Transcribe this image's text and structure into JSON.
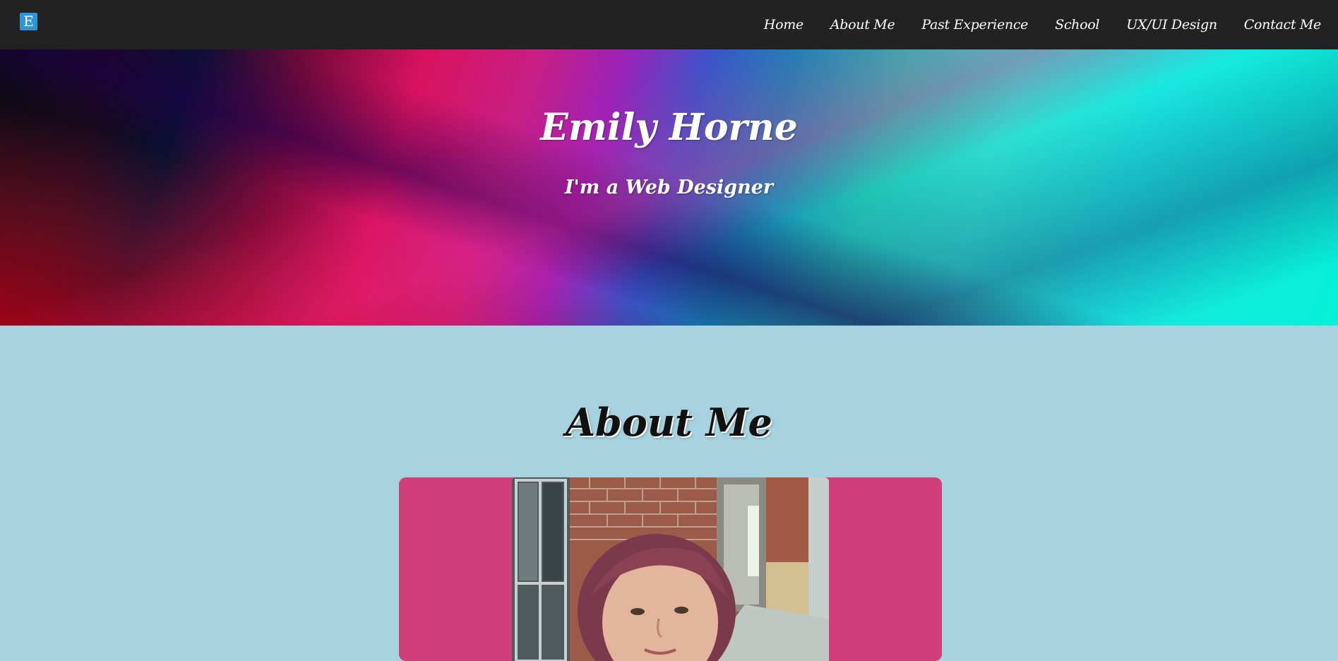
{
  "navbar": {
    "logo_text": "E",
    "links": [
      {
        "label": "Home"
      },
      {
        "label": "About Me"
      },
      {
        "label": "Past Experience"
      },
      {
        "label": "School"
      },
      {
        "label": "UX/UI Design"
      },
      {
        "label": "Contact Me"
      }
    ]
  },
  "hero": {
    "title": "Emily Horne",
    "subtitle": "I'm a Web Designer"
  },
  "about": {
    "heading": "About Me"
  },
  "colors": {
    "navbar_bg": "#222222",
    "page_bg": "#a6d3df",
    "card_bg": "#cf3f79",
    "logo_bg": "#2f95d6"
  }
}
